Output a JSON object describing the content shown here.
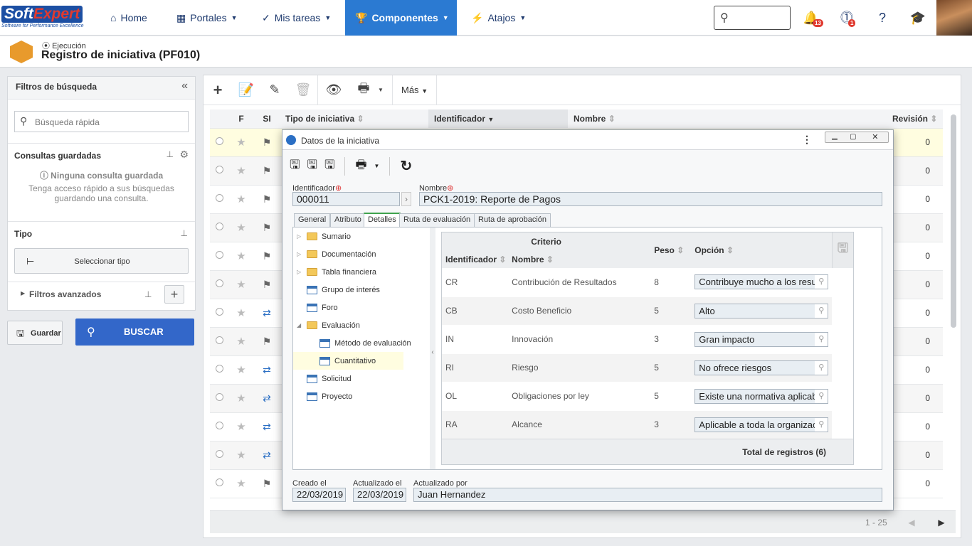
{
  "topbar": {
    "logo_text": "Soft",
    "logo_text2": "Expert",
    "logo_tagline": "Software for Performance Excellence",
    "nav": [
      {
        "label": "Home",
        "icon": "home-icon"
      },
      {
        "label": "Portales",
        "icon": "grid-icon"
      },
      {
        "label": "Mis tareas",
        "icon": "check-icon"
      },
      {
        "label": "Componentes",
        "icon": "trophy-icon"
      },
      {
        "label": "Atajos",
        "icon": "bolt-icon"
      }
    ],
    "notifications_count": "13",
    "alerts_count": "1"
  },
  "page": {
    "section": "Ejecución",
    "title": "Registro de iniciativa (PF010)"
  },
  "filters": {
    "title": "Filtros de búsqueda",
    "quick_search_placeholder": "Búsqueda rápida",
    "saved_title": "Consultas guardadas",
    "saved_none": "Ninguna consulta guardada",
    "saved_hint": "Tenga acceso rápido a sus búsquedas guardando una consulta.",
    "tipo_title": "Tipo",
    "select_type": "Seleccionar tipo",
    "advanced": "Filtros avanzados",
    "save_label": "Guardar",
    "search_label": "BUSCAR"
  },
  "grid": {
    "more_label": "Más",
    "columns": {
      "f": "F",
      "si": "SI",
      "tipo": "Tipo de iniciativa",
      "id": "Identificador",
      "nombre": "Nombre",
      "rev": "Revisión"
    },
    "rows": [
      {
        "icon": "checkered-flag-icon",
        "rev": "0"
      },
      {
        "icon": "checkered-flag-icon",
        "rev": "0"
      },
      {
        "icon": "checkered-flag-icon",
        "rev": "0"
      },
      {
        "icon": "checkered-flag-icon",
        "rev": "0"
      },
      {
        "icon": "checkered-flag-icon",
        "rev": "0"
      },
      {
        "icon": "checkered-flag-icon",
        "rev": "0"
      },
      {
        "icon": "workflow-icon",
        "rev": "0"
      },
      {
        "icon": "checkered-flag-icon",
        "rev": "0"
      },
      {
        "icon": "workflow-icon",
        "rev": "0"
      },
      {
        "icon": "workflow-icon",
        "rev": "0"
      },
      {
        "icon": "workflow-icon",
        "rev": "0"
      },
      {
        "icon": "workflow-icon",
        "rev": "0"
      },
      {
        "icon": "checkered-flag-icon",
        "rev": "0"
      }
    ],
    "pager": "1 - 25"
  },
  "modal": {
    "title": "Datos de la iniciativa",
    "id_label": "Identificador",
    "id_value": "000011",
    "name_label": "Nombre",
    "name_value": "PCK1-2019: Reporte de Pagos",
    "tabs": [
      "General",
      "Atributo",
      "Detalles",
      "Ruta de evaluación",
      "Ruta de aprobación"
    ],
    "tree": [
      {
        "label": "Sumario",
        "kind": "folder",
        "level": 0,
        "expander": "▷"
      },
      {
        "label": "Documentación",
        "kind": "folder",
        "level": 0,
        "expander": "▷"
      },
      {
        "label": "Tabla financiera",
        "kind": "folder",
        "level": 0,
        "expander": "▷"
      },
      {
        "label": "Grupo de interés",
        "kind": "doc",
        "level": 0,
        "expander": ""
      },
      {
        "label": "Foro",
        "kind": "doc",
        "level": 0,
        "expander": ""
      },
      {
        "label": "Evaluación",
        "kind": "folder",
        "level": 0,
        "expander": "◢"
      },
      {
        "label": "Método de evaluación",
        "kind": "doc",
        "level": 1,
        "expander": ""
      },
      {
        "label": "Cuantitativo",
        "kind": "doc",
        "level": 1,
        "expander": "",
        "selected": true
      },
      {
        "label": "Solicitud",
        "kind": "doc",
        "level": 0,
        "expander": ""
      },
      {
        "label": "Proyecto",
        "kind": "doc",
        "level": 0,
        "expander": ""
      }
    ],
    "criteria": {
      "group_header": "Criterio",
      "col_id": "Identificador",
      "col_name": "Nombre",
      "col_weight": "Peso",
      "col_option": "Opción",
      "rows": [
        {
          "id": "CR",
          "name": "Contribución de Resultados",
          "weight": "8",
          "option": "Contribuye mucho a los resultados"
        },
        {
          "id": "CB",
          "name": "Costo Beneficio",
          "weight": "5",
          "option": "Alto"
        },
        {
          "id": "IN",
          "name": "Innovación",
          "weight": "3",
          "option": "Gran impacto"
        },
        {
          "id": "RI",
          "name": "Riesgo",
          "weight": "5",
          "option": "No ofrece riesgos"
        },
        {
          "id": "OL",
          "name": "Obligaciones por ley",
          "weight": "5",
          "option": "Existe una normativa aplicable"
        },
        {
          "id": "RA",
          "name": "Alcance",
          "weight": "3",
          "option": "Aplicable a toda la organización"
        }
      ],
      "total": "Total de registros (6)"
    },
    "created_label": "Creado el",
    "created_value": "22/03/2019",
    "updated_label": "Actualizado el",
    "updated_value": "22/03/2019",
    "updated_by_label": "Actualizado por",
    "updated_by_value": "Juan Hernandez"
  }
}
